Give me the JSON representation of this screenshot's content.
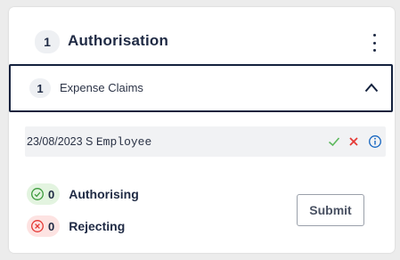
{
  "header": {
    "count": "1",
    "title": "Authorisation",
    "menu_icon": "more-vertical-icon"
  },
  "accordion": {
    "count": "1",
    "label": "Expense Claims",
    "expanded": true,
    "toggle_icon": "chevron-up-icon"
  },
  "claim": {
    "date_prefix": "23/08/2023 S ",
    "name": "Employee",
    "actions": [
      {
        "icon": "check-icon",
        "color": "#5cb85c"
      },
      {
        "icon": "close-icon",
        "color": "#e53935"
      },
      {
        "icon": "info-icon",
        "color": "#1565c0"
      }
    ]
  },
  "summary": {
    "authorising": {
      "count": "0",
      "label": "Authorising",
      "icon": "check-circle-icon",
      "color": "#3c9a3c"
    },
    "rejecting": {
      "count": "0",
      "label": "Rejecting",
      "icon": "x-circle-icon",
      "color": "#e53935"
    }
  },
  "submit_label": "Submit"
}
